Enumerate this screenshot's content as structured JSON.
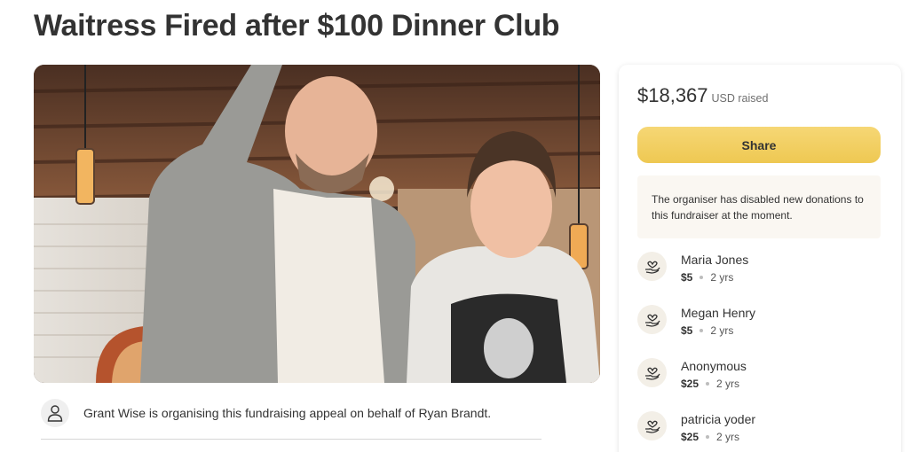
{
  "page": {
    "title": "Waitress Fired after $100 Dinner Club"
  },
  "hero": {
    "icon": "campaign-photo"
  },
  "organiser": {
    "text": "Grant Wise is organising this fundraising appeal on behalf of Ryan Brandt.",
    "icon": "person-icon"
  },
  "sidebar": {
    "raised_amount": "$18,367",
    "raised_label": "USD raised",
    "share_label": "Share",
    "notice": "The organiser has disabled new donations to this fundraiser at the moment.",
    "donations": [
      {
        "name": "Maria Jones",
        "amount": "$5",
        "time": "2 yrs"
      },
      {
        "name": "Megan Henry",
        "amount": "$5",
        "time": "2 yrs"
      },
      {
        "name": "Anonymous",
        "amount": "$25",
        "time": "2 yrs"
      },
      {
        "name": "patricia yoder",
        "amount": "$25",
        "time": "2 yrs"
      }
    ]
  },
  "colors": {
    "share_button": "#f2cf63",
    "notice_bg": "#faf7f2",
    "donor_icon_bg": "#f3efe7"
  }
}
